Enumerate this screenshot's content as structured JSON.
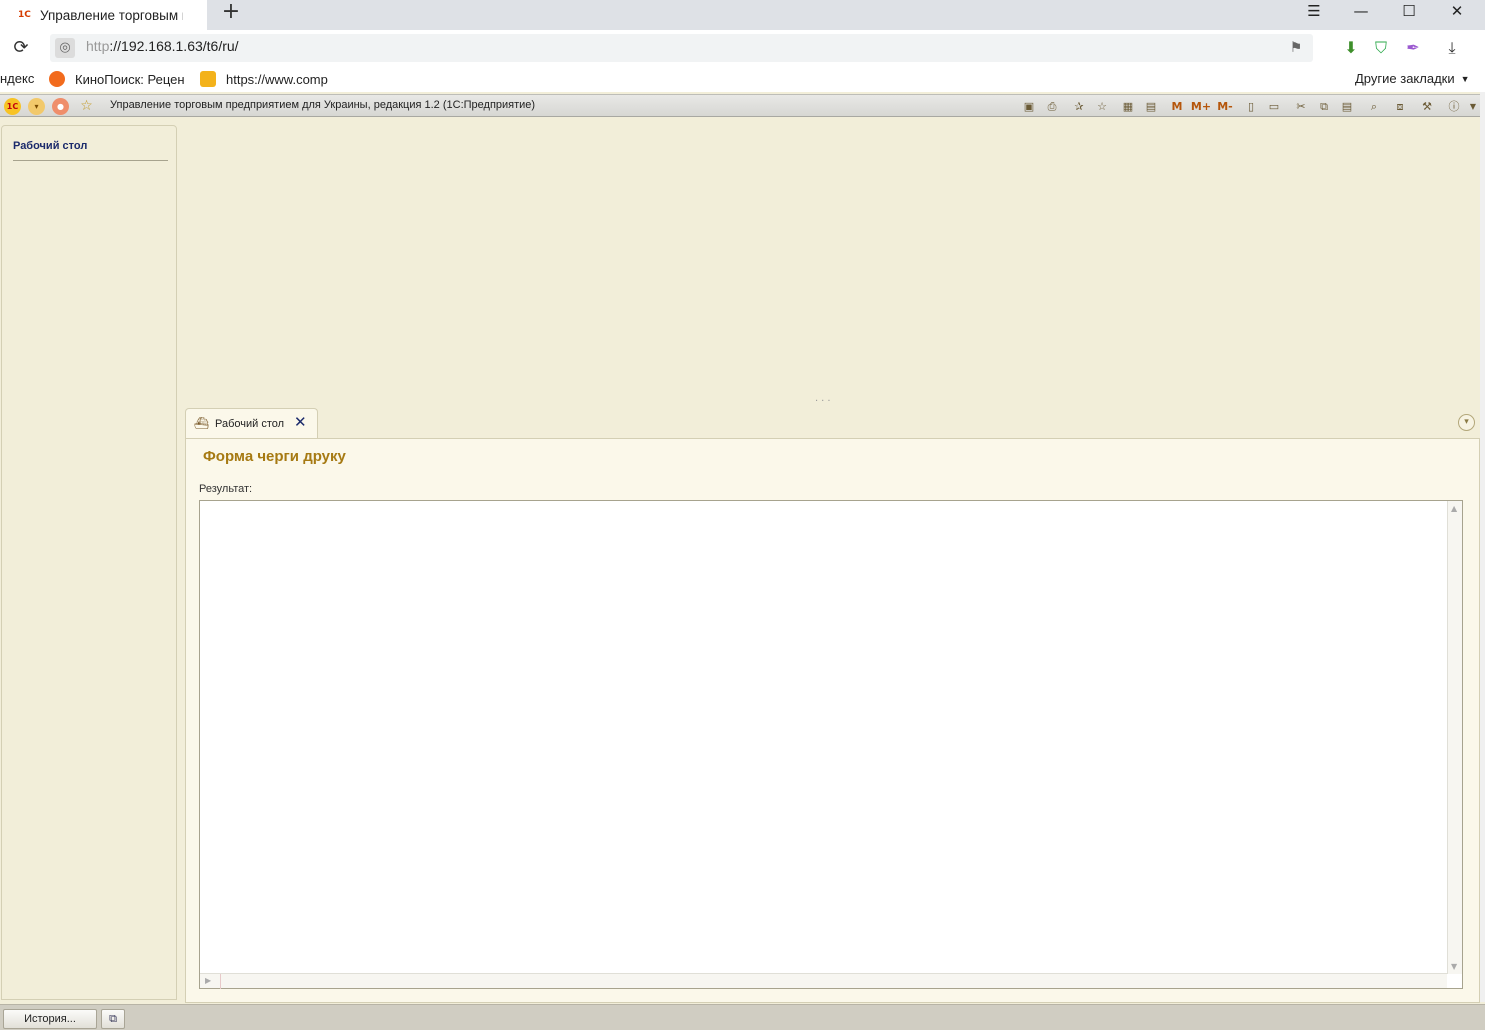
{
  "browser": {
    "tab_title": "Управление торговым п",
    "tab_favicon": "1С",
    "new_tab": "+",
    "url_protocol": "http",
    "url_rest": "://192.168.1.63/t6/ru/",
    "window_controls": {
      "menu": "☰",
      "minimize": "—",
      "maximize": "☐",
      "close": "✕"
    }
  },
  "bookmarks": {
    "items": [
      {
        "label": "ндекс"
      },
      {
        "label": "КиноПоиск: Рецен"
      },
      {
        "label": "https://www.comp"
      }
    ],
    "other": "Другие закладки"
  },
  "app": {
    "title": "Управление торговым предприятием для Украины, редакция 1.2   (1С:Предприятие)",
    "logo": "1С",
    "toolbar_m": [
      "M",
      "M+",
      "M-"
    ]
  },
  "sidebar": {
    "items": [
      {
        "label": "Рабочий стол"
      }
    ]
  },
  "form": {
    "tab_label": "Рабочий стол",
    "title": "Форма черги друку",
    "result_label": "Результат:"
  },
  "statusbar": {
    "history_label": "История..."
  },
  "colors": {
    "app_bg": "#f2eed9",
    "form_title": "#a67a13",
    "nav_link": "#1b2a6b"
  }
}
